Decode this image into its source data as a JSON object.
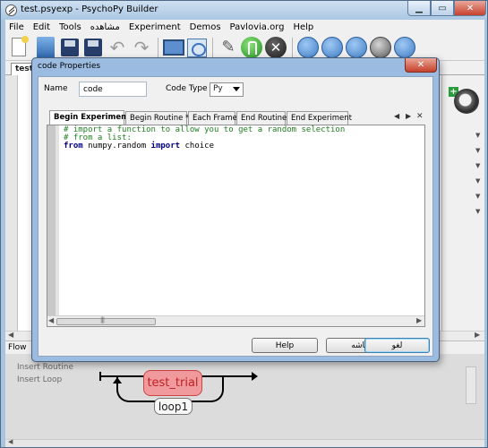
{
  "window": {
    "title": "test.psyexp - PsychoPy Builder"
  },
  "menu": [
    "File",
    "Edit",
    "Tools",
    "مشاهده",
    "Experiment",
    "Demos",
    "Pavlovia.org",
    "Help"
  ],
  "toolbar_icons": [
    "new-file-icon",
    "open-file-icon",
    "save-icon",
    "save-as-icon",
    "undo-icon",
    "redo-icon",
    "monitor-center-icon",
    "preferences-icon",
    "compile-script-icon",
    "run-icon",
    "stop-icon",
    "pavlovia-sync-icon",
    "pavlovia-search-icon",
    "pavlovia-globe-icon",
    "pavlovia-user-icon",
    "pavlovia-project-icon"
  ],
  "routine_tab": {
    "label": "test_"
  },
  "flow": {
    "label": "Flow",
    "insert_routine": "Insert Routine",
    "insert_loop": "Insert Loop",
    "routine_name": "test_trial",
    "loop_name": "loop1"
  },
  "dialog": {
    "title": "code Properties",
    "name_label": "Name",
    "name_value": "code",
    "code_type_label": "Code Type",
    "code_type_value": "Py",
    "tabs": [
      {
        "label": "Begin Experiment *",
        "active": true
      },
      {
        "label": "Begin Routine *",
        "active": false
      },
      {
        "label": "Each Frame",
        "active": false
      },
      {
        "label": "End Routine",
        "active": false
      },
      {
        "label": "End Experiment",
        "active": false
      }
    ],
    "code": {
      "line1": "# import a function to allow you to get a random selection",
      "line2": "# from a list:",
      "line3_kw1": "from",
      "line3_mod": " numpy.random ",
      "line3_kw2": "import",
      "line3_name": " choice"
    },
    "buttons": {
      "help": "Help",
      "ok": "باشه",
      "cancel": "لغو"
    }
  },
  "colors": {
    "titlebar": "#aac7e3",
    "routine_fill": "#f09a9d",
    "routine_text": "#c01f25",
    "comment": "#1f7f1f",
    "keyword": "#00007f"
  }
}
